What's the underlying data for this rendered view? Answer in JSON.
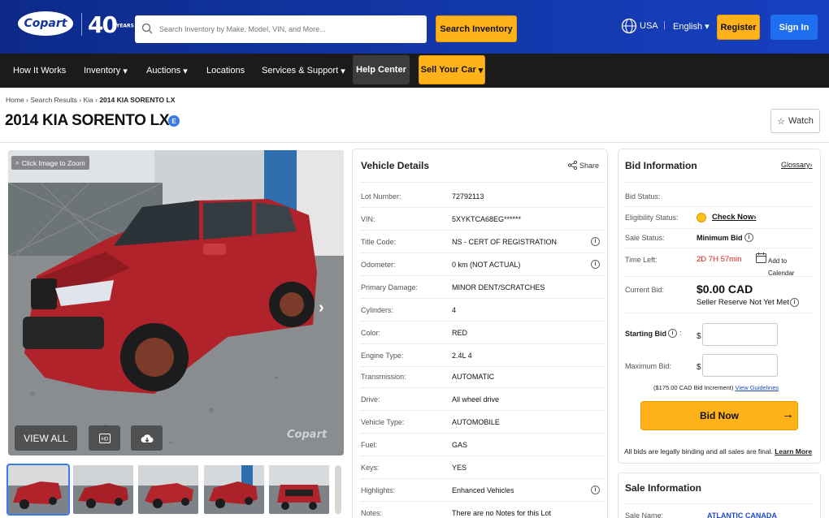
{
  "header": {
    "logo_text": "Copart",
    "years_text": "40",
    "years_sub": "YEARS",
    "search_placeholder": "Search Inventory by Make, Model, VIN, and More...",
    "search_button": "Search Inventory",
    "country": "USA",
    "separator": "|",
    "language": "English",
    "register": "Register",
    "sign_in": "Sign In"
  },
  "nav": {
    "how_it_works": "How It Works",
    "inventory": "Inventory",
    "auctions": "Auctions",
    "locations": "Locations",
    "services": "Services & Support",
    "help_center": "Help Center",
    "sell": "Sell Your Car"
  },
  "breadcrumb": {
    "home": "Home",
    "search_results": "Search Results",
    "make": "Kia",
    "current": "2014 KIA SORENTO LX"
  },
  "page": {
    "title": "2014 KIA SORENTO LX",
    "badge": "E",
    "watch": "Watch"
  },
  "gallery": {
    "zoom_label": "Click Image to Zoom",
    "view_all": "VIEW ALL",
    "hd_label": "HD",
    "watermark": "Copart"
  },
  "vehicle_details": {
    "title": "Vehicle Details",
    "share": "Share",
    "rows": [
      {
        "label": "Lot Number:",
        "value": "72792113"
      },
      {
        "label": "VIN:",
        "value": "5XYKTCA68EG******"
      },
      {
        "label": "Title Code:",
        "value": "NS - CERT OF REGISTRATION"
      },
      {
        "label": "Odometer:",
        "value": "0 km (NOT ACTUAL)"
      },
      {
        "label": "Primary Damage:",
        "value": "MINOR DENT/SCRATCHES"
      },
      {
        "label": "Cylinders:",
        "value": "4"
      },
      {
        "label": "Color:",
        "value": "RED"
      },
      {
        "label": "Engine Type:",
        "value": "2.4L 4"
      },
      {
        "label": "Transmission:",
        "value": "AUTOMATIC"
      },
      {
        "label": "Drive:",
        "value": "All wheel drive"
      },
      {
        "label": "Vehicle Type:",
        "value": "AUTOMOBILE"
      },
      {
        "label": "Fuel:",
        "value": "GAS"
      },
      {
        "label": "Keys:",
        "value": "YES"
      },
      {
        "label": "Highlights:",
        "value": "Enhanced Vehicles"
      },
      {
        "label": "Notes:",
        "value": "There are no Notes for this Lot"
      }
    ]
  },
  "bid_info": {
    "title": "Bid Information",
    "glossary": "Glossary",
    "bid_status_label": "Bid Status:",
    "eligibility_label": "Eligibility Status:",
    "check_now": "Check Now",
    "sale_status_label": "Sale Status:",
    "sale_status_value": "Minimum Bid",
    "time_left_label": "Time Left:",
    "time_left_value": "2D 7H 57min",
    "add_to_calendar": "Add to Calendar",
    "current_bid_label": "Current Bid:",
    "current_bid_value": "$0.00 CAD",
    "reserve": "Seller Reserve Not Yet Met",
    "starting_bid_label": "Starting Bid",
    "maximum_bid_label": "Maximum Bid:",
    "currency_symbol": "$",
    "increment_text": "($175.00 CAD Bid Increment)",
    "view_guidelines": "View Guidelines",
    "bid_now": "Bid Now",
    "legal_text": "All bids are legally binding and all sales are final.",
    "learn_more": "Learn More"
  },
  "sale_info": {
    "title": "Sale Information",
    "sale_name_label": "Sale Name:",
    "sale_name_value": "ATLANTIC CANADA"
  }
}
